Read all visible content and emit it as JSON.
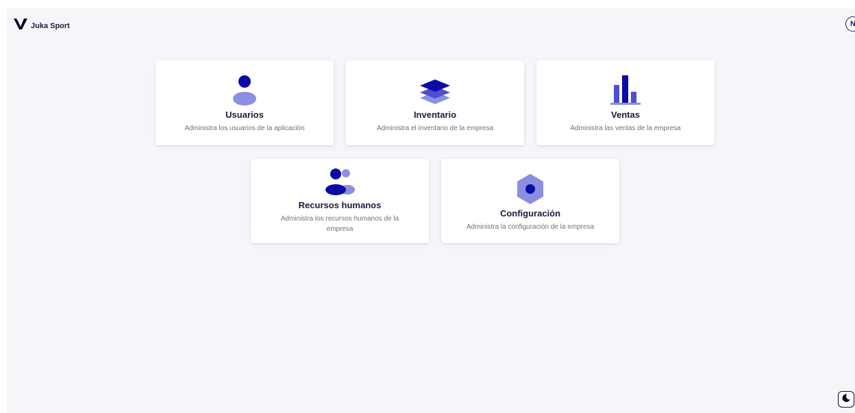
{
  "header": {
    "brand_name": "Juka Sport",
    "logo_icon": "juka-logo-icon",
    "avatar_initial": "N"
  },
  "cards": [
    {
      "title": "Usuarios",
      "description": "Administra los usuarios de la aplicación",
      "icon": "user-icon"
    },
    {
      "title": "Inventario",
      "description": "Administra el inventario de la empresa",
      "icon": "layers-icon"
    },
    {
      "title": "Ventas",
      "description": "Administra las ventas de la empresa",
      "icon": "bar-chart-icon"
    },
    {
      "title": "Recursos humanos",
      "description": "Administra los recursos humanos de la empresa",
      "icon": "users-icon"
    },
    {
      "title": "Configuración",
      "description": "Administra la configuración de la empresa",
      "icon": "settings-hexagon-icon"
    }
  ],
  "theme_toggle_icon": "moon-icon",
  "colors": {
    "primary": "#0d0ba8",
    "secondary": "#8b8fe0",
    "background": "#f6f6fa",
    "text": "#1b1b3a",
    "muted": "#6f6f80"
  }
}
